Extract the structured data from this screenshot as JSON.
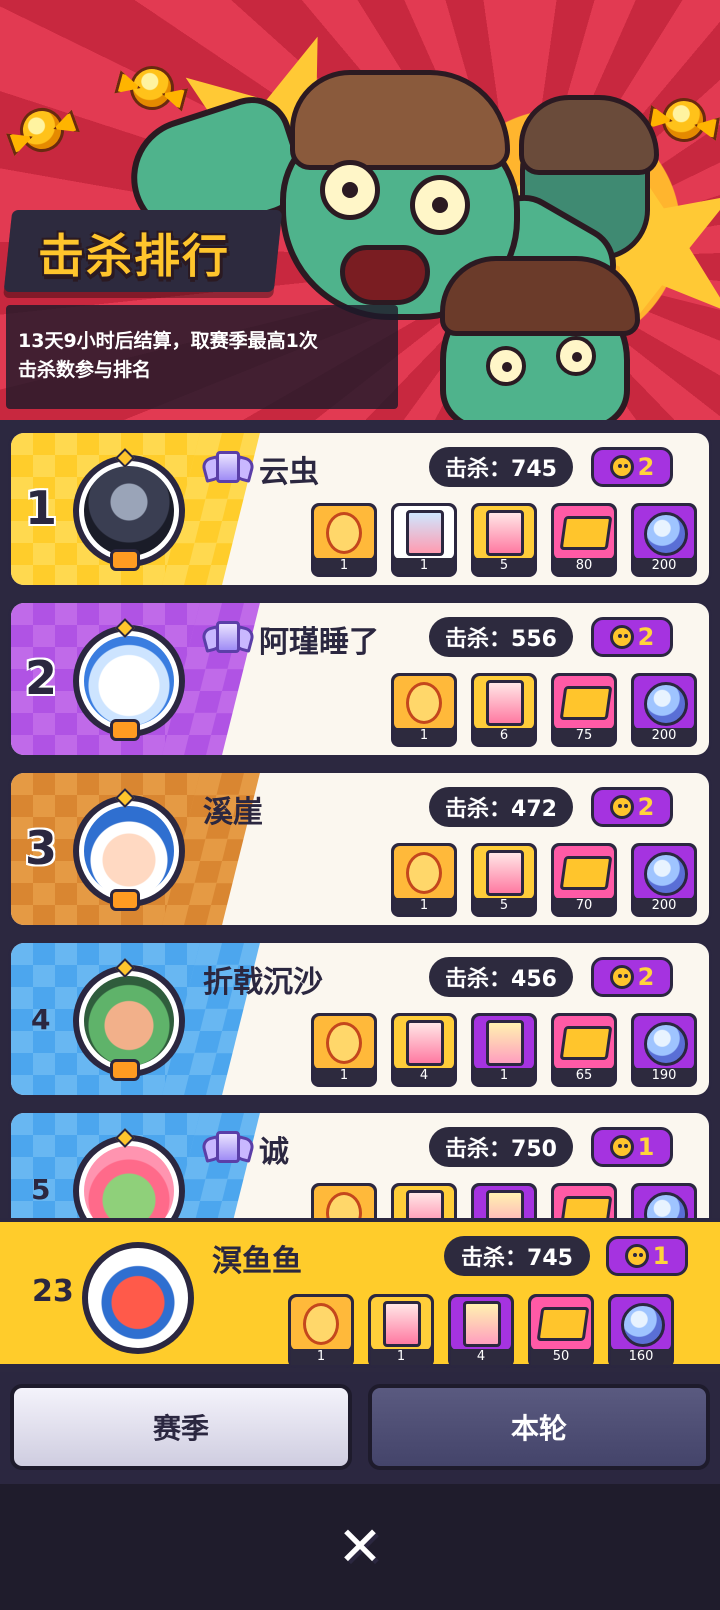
{
  "header": {
    "title": "击杀排行",
    "description_line1": "13天9小时后结算，取赛季最高1次",
    "description_line2": "击杀数参与排名"
  },
  "rankings": [
    {
      "rank": "1",
      "name": "云虫",
      "kills": "击杀：745",
      "skulls": "2",
      "vip": true,
      "rewards": [
        {
          "type": "frame",
          "qty": "1"
        },
        {
          "type": "card-white",
          "qty": "1"
        },
        {
          "type": "card",
          "qty": "5"
        },
        {
          "type": "ticket",
          "qty": "80"
        },
        {
          "type": "capsule",
          "qty": "200"
        }
      ]
    },
    {
      "rank": "2",
      "name": "阿瑾睡了",
      "kills": "击杀：556",
      "skulls": "2",
      "vip": true,
      "rewards": [
        {
          "type": "frame",
          "qty": "1"
        },
        {
          "type": "card",
          "qty": "6"
        },
        {
          "type": "ticket",
          "qty": "75"
        },
        {
          "type": "capsule",
          "qty": "200"
        }
      ]
    },
    {
      "rank": "3",
      "name": "溪崖",
      "kills": "击杀：472",
      "skulls": "2",
      "vip": false,
      "rewards": [
        {
          "type": "frame",
          "qty": "1"
        },
        {
          "type": "card",
          "qty": "5"
        },
        {
          "type": "ticket",
          "qty": "70"
        },
        {
          "type": "capsule",
          "qty": "200"
        }
      ]
    },
    {
      "rank": "4",
      "name": "折戟沉沙",
      "kills": "击杀：456",
      "skulls": "2",
      "vip": false,
      "rewards": [
        {
          "type": "frame",
          "qty": "1"
        },
        {
          "type": "card",
          "qty": "4"
        },
        {
          "type": "card-purple",
          "qty": "1"
        },
        {
          "type": "ticket",
          "qty": "65"
        },
        {
          "type": "capsule",
          "qty": "190"
        }
      ]
    },
    {
      "rank": "5",
      "name": "诚",
      "kills": "击杀：750",
      "skulls": "1",
      "vip": true,
      "rewards": [
        {
          "type": "frame",
          "qty": ""
        },
        {
          "type": "card",
          "qty": ""
        },
        {
          "type": "card-purple",
          "qty": ""
        },
        {
          "type": "ticket",
          "qty": ""
        },
        {
          "type": "capsule",
          "qty": ""
        }
      ]
    }
  ],
  "self": {
    "rank": "23",
    "name": "溟鱼鱼",
    "kills": "击杀：745",
    "skulls": "1",
    "rewards": [
      {
        "type": "frame",
        "qty": "1"
      },
      {
        "type": "card",
        "qty": "1"
      },
      {
        "type": "card-purple",
        "qty": "4"
      },
      {
        "type": "ticket",
        "qty": "50"
      },
      {
        "type": "capsule",
        "qty": "160"
      }
    ]
  },
  "tabs": {
    "season": "赛季",
    "round": "本轮"
  },
  "close_icon": "✕",
  "colors": {
    "accent_yellow": "#ffcc2b",
    "skull_purple": "#a533e0",
    "dark": "#2b2740"
  }
}
